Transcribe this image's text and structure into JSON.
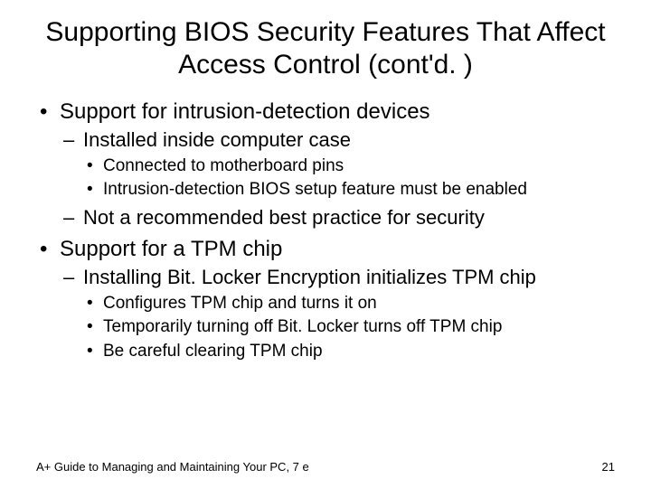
{
  "title": "Supporting BIOS Security Features That Affect Access Control (cont'd. )",
  "bullets": [
    {
      "text": "Support for intrusion-detection devices",
      "children": [
        {
          "text": "Installed inside computer case",
          "children": [
            {
              "text": "Connected to motherboard pins"
            },
            {
              "text": "Intrusion-detection BIOS setup feature must be enabled"
            }
          ]
        },
        {
          "text": "Not a recommended best practice for security"
        }
      ]
    },
    {
      "text": "Support for a TPM chip",
      "children": [
        {
          "text": "Installing Bit. Locker Encryption initializes TPM chip",
          "children": [
            {
              "text": "Configures TPM chip and turns it on"
            },
            {
              "text": "Temporarily turning off Bit. Locker turns off TPM chip"
            },
            {
              "text": "Be careful clearing TPM chip"
            }
          ]
        }
      ]
    }
  ],
  "footer": {
    "left": "A+ Guide to Managing and Maintaining Your PC, 7 e",
    "right": "21"
  }
}
